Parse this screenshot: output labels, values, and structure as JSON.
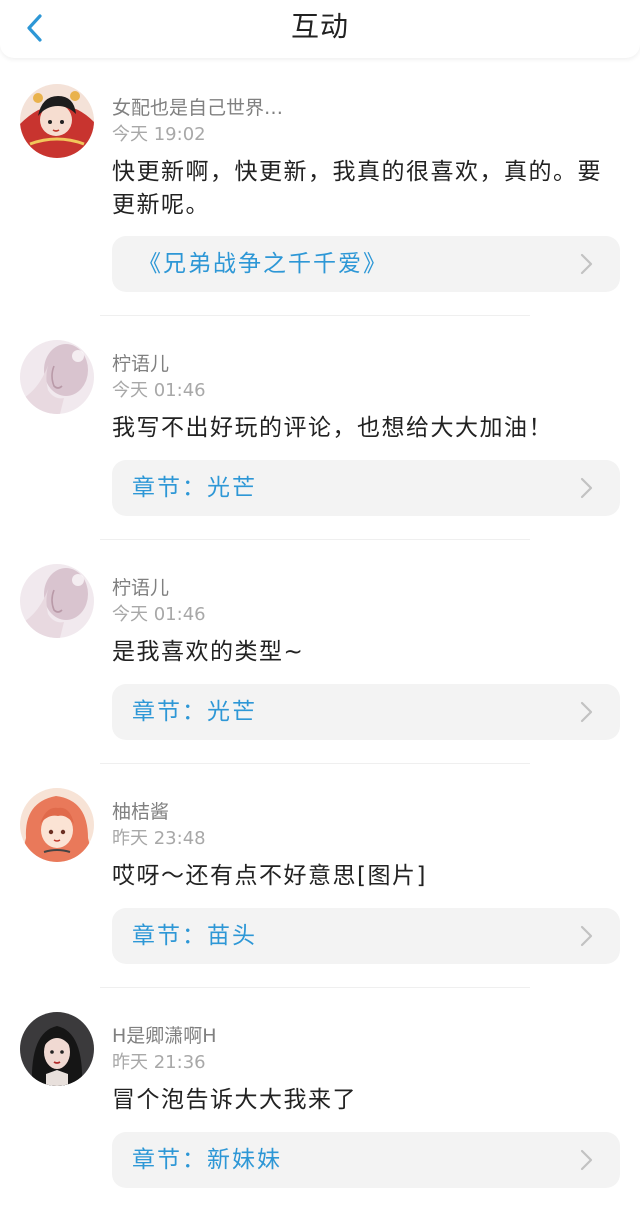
{
  "header": {
    "title": "互动"
  },
  "items": [
    {
      "name": "女配也是自己世界…",
      "time": "今天 19:02",
      "content": "快更新啊，快更新，我真的很喜欢，真的。要更新呢。",
      "link": "《兄弟战争之千千爱》"
    },
    {
      "name": "柠语儿",
      "time": "今天 01:46",
      "content": "我写不出好玩的评论，也想给大大加油！",
      "link": "章节：光芒"
    },
    {
      "name": "柠语儿",
      "time": "今天 01:46",
      "content": "是我喜欢的类型~",
      "link": "章节：光芒"
    },
    {
      "name": "柚桔酱",
      "time": "昨天 23:48",
      "content": "哎呀～还有点不好意思[图片]",
      "link": "章节：苗头"
    },
    {
      "name": "H是卿潇啊H",
      "time": "昨天 21:36",
      "content": "冒个泡告诉大大我来了",
      "link": "章节：新妹妹"
    }
  ],
  "colors": {
    "accent": "#2d97d6",
    "card_bg": "#f3f3f3",
    "name": "#808080",
    "time": "#a8a8a8"
  },
  "icons": {
    "back": "chevron-left-icon",
    "row_arrow": "chevron-right-icon"
  }
}
